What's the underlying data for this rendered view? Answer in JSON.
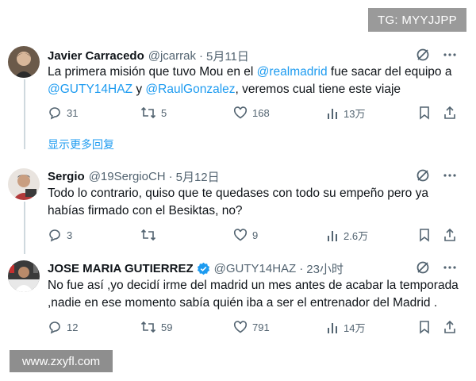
{
  "watermarks": {
    "top_right": "TG: MYYJJPP",
    "bottom_left": "www.zxyfl.com"
  },
  "tweets": [
    {
      "name": "Javier Carracedo",
      "handle": "@jcarrak",
      "time": "5月11日",
      "text_parts": [
        "La primera misión que tuvo Mou en el ",
        "@realmadrid",
        " fue sacar del equipo a ",
        "@GUTY14HAZ",
        " y ",
        "@RaulGonzalez",
        ", veremos cual tiene este viaje"
      ],
      "replies": "31",
      "retweets": "5",
      "likes": "168",
      "views": "13万"
    },
    {
      "name": "Sergio",
      "handle": "@19SergioCH",
      "time": "5月12日",
      "text": "Todo lo contrario, quiso que te quedases con todo su empeño pero ya habías firmado con el Besiktas, no?",
      "replies": "3",
      "retweets": "",
      "likes": "9",
      "views": "2.6万"
    },
    {
      "name": "JOSE MARIA GUTIERREZ",
      "handle": "@GUTY14HAZ",
      "time": "23小时",
      "verified": true,
      "text": "No fue así ,yo decidí irme del madrid un mes antes de acabar la temporada ,nadie en ese momento sabía quién iba a ser el entrenador del Madrid .",
      "replies": "12",
      "retweets": "59",
      "likes": "791",
      "views": "14万"
    }
  ],
  "show_more_replies": "显示更多回复",
  "colors": {
    "accent": "#1d9bf0",
    "muted": "#536471",
    "text": "#0f1419",
    "line": "#cfd9de"
  }
}
